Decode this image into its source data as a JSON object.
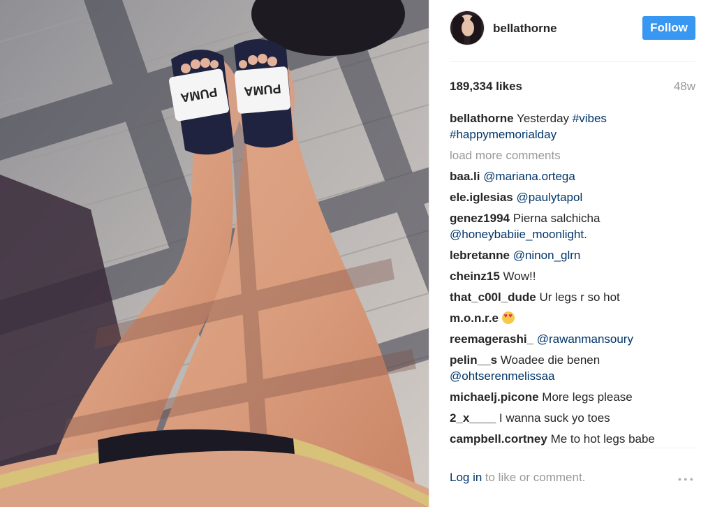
{
  "header": {
    "username": "bellathorne",
    "follow_label": "Follow"
  },
  "stats": {
    "likes": "189,334 likes",
    "age": "48w"
  },
  "caption": {
    "username": "bellathorne",
    "text": "Yesterday",
    "tag1": "#vibes",
    "tag2": "#happymemorialday"
  },
  "load_more": "load more comments",
  "comments": [
    {
      "user": "baa.li",
      "mention": "@mariana.ortega"
    },
    {
      "user": "ele.iglesias",
      "mention": "@paulytapol"
    },
    {
      "user": "genez1994",
      "text": "Pierna salchicha",
      "mention": "@honeybabiie_moonlight",
      "suffix": "."
    },
    {
      "user": "lebretanne",
      "mention": "@ninon_glrn"
    },
    {
      "user": "cheinz15",
      "text": "Wow!!"
    },
    {
      "user": "that_c00l_dude",
      "text": "Ur legs r so hot"
    },
    {
      "user": "m.o.n.r.e",
      "emoji": "heart-eyes-emoji"
    },
    {
      "user": "reemagerashi_",
      "mention": "@rawanmansoury"
    },
    {
      "user": "pelin__s",
      "text": "Woadee die benen",
      "mention": "@ohtserenmelissaa"
    },
    {
      "user": "michaelj.picone",
      "text": "More legs please"
    },
    {
      "user": "2_x____",
      "text": "I wanna suck yo toes"
    },
    {
      "user": "campbell.cortney",
      "text": "Me to hot legs babe"
    }
  ],
  "footer": {
    "login_label": "Log in",
    "login_rest": "to like or comment.",
    "more_icon": "more-options-icon"
  },
  "photo": {
    "slide_brand_left": "PUMA",
    "slide_brand_right": "PUMA"
  },
  "colors": {
    "follow_bg": "#3897f0",
    "link": "#003569",
    "muted": "#999999",
    "text": "#262626"
  }
}
